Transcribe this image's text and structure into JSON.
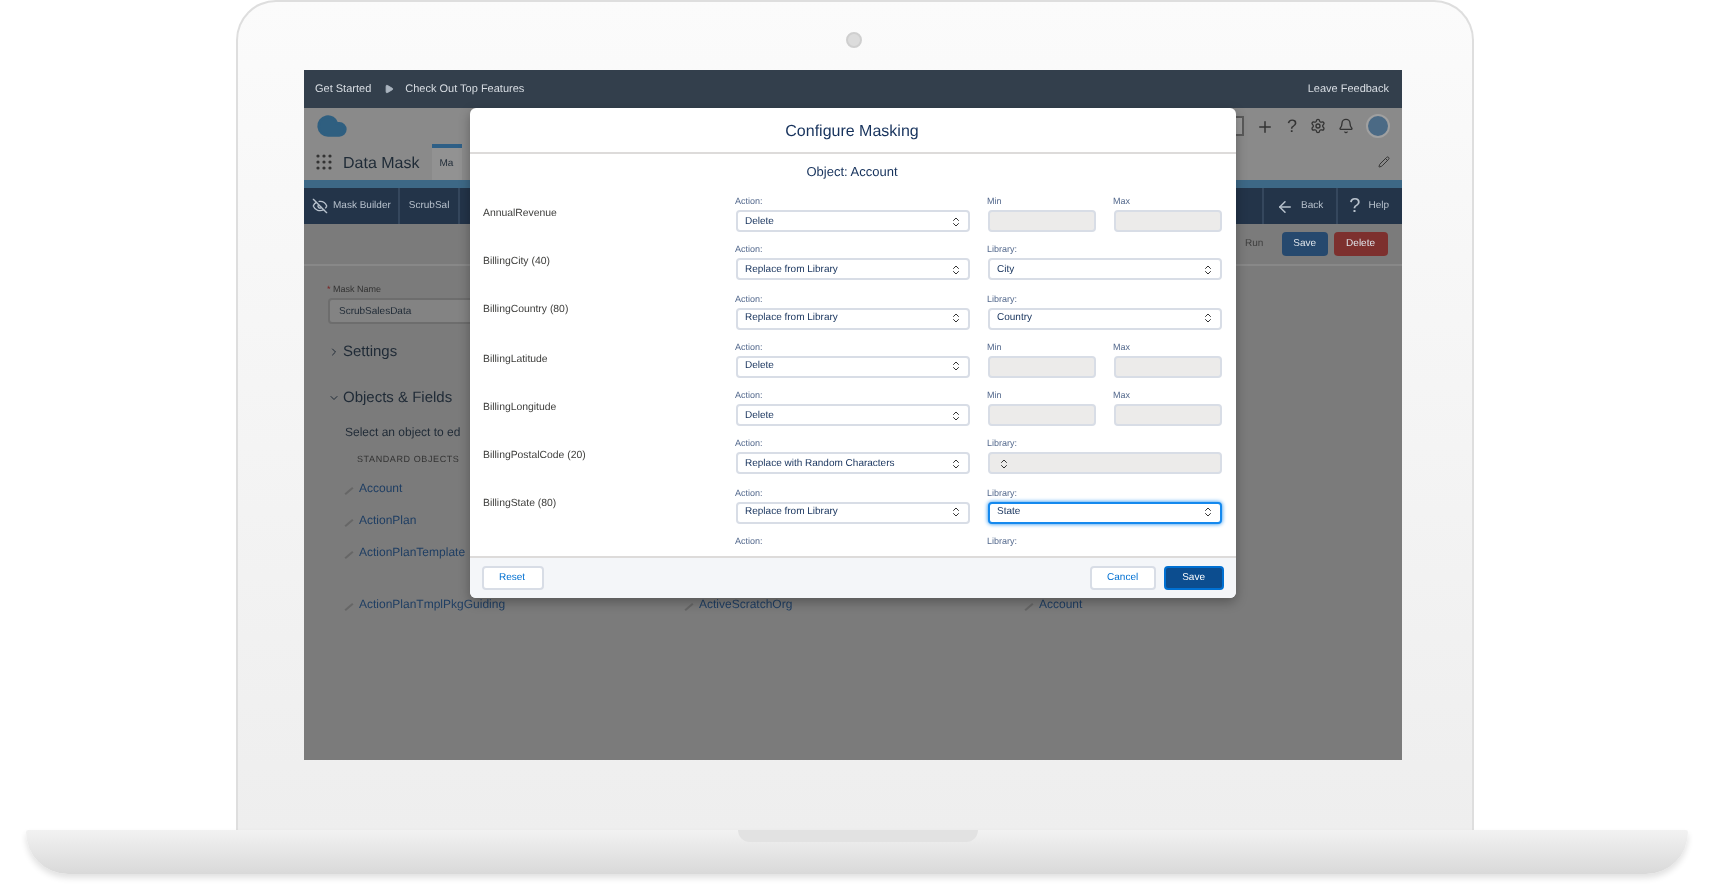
{
  "top_bar": {
    "links": [
      "Get Started",
      "Check Out Top Features"
    ],
    "feedback": "Leave Feedback"
  },
  "header": {
    "help_icon": "?",
    "app_name": "Data Mask",
    "tabs": [
      {
        "label": "Ma",
        "selected": true
      }
    ]
  },
  "toolbar": {
    "items": [
      "Mask Builder",
      "ScrubSal"
    ],
    "nav": [
      {
        "kind": "back",
        "label": "Back"
      },
      {
        "kind": "help",
        "icon": "?",
        "label": "Help"
      }
    ]
  },
  "actions": [
    {
      "label": "Run",
      "kind": "disabled"
    },
    {
      "label": "Save",
      "kind": "primary"
    },
    {
      "label": "Delete",
      "kind": "danger"
    }
  ],
  "mask_form": {
    "required_mark": "*",
    "name_label": "Mask Name",
    "name_value": "ScrubSalesData",
    "sections": [
      {
        "title": "Settings",
        "expanded": false
      },
      {
        "title": "Objects & Fields",
        "expanded": true
      }
    ],
    "hint": "Select an object to ed",
    "group": "STANDARD OBJECTS",
    "objects": [
      [
        "Account"
      ],
      [
        "ActionPlan"
      ],
      [
        "ActionPlanTemplate"
      ],
      [
        "ActionPlanTmplPkgGuiding",
        "ActiveScratchOrg",
        "Account"
      ]
    ]
  },
  "modal": {
    "title": "Configure Masking",
    "object": "Object: Account",
    "rows": [
      {
        "kind": "range",
        "label": "AnnualRevenue",
        "action_caption": "Action:",
        "action": "Delete",
        "min_caption": "Min",
        "max_caption": "Max",
        "disabled": true
      },
      {
        "kind": "library",
        "label": "BillingCity (40)",
        "action_caption": "Action:",
        "action": "Replace from Library",
        "library_caption": "Library:",
        "library": "City",
        "disabled": false,
        "focused": false
      },
      {
        "kind": "library",
        "label": "BillingCountry (80)",
        "action_caption": "Action:",
        "action": "Replace from Library",
        "library_caption": "Library:",
        "library": "Country",
        "disabled": false,
        "focused": false
      },
      {
        "kind": "range",
        "label": "BillingLatitude",
        "action_caption": "Action:",
        "action": "Delete",
        "min_caption": "Min",
        "max_caption": "Max",
        "disabled": true
      },
      {
        "kind": "range",
        "label": "BillingLongitude",
        "action_caption": "Action:",
        "action": "Delete",
        "min_caption": "Min",
        "max_caption": "Max",
        "disabled": true
      },
      {
        "kind": "library",
        "label": "BillingPostalCode (20)",
        "action_caption": "Action:",
        "action": "Replace with Random Characters",
        "library_caption": "Library:",
        "disabled": true,
        "focused": false
      },
      {
        "kind": "library",
        "label": "BillingState (80)",
        "action_caption": "Action:",
        "action": "Replace from Library",
        "library_caption": "Library:",
        "library": "State",
        "disabled": false,
        "focused": true
      },
      {
        "kind": "partial",
        "action_caption": "Action:",
        "library_caption": "Library:"
      }
    ],
    "buttons": [
      {
        "label": "Reset",
        "kind": "neutral"
      },
      {
        "label": "Cancel",
        "kind": "neutral"
      },
      {
        "label": "Save",
        "kind": "brand"
      }
    ]
  }
}
